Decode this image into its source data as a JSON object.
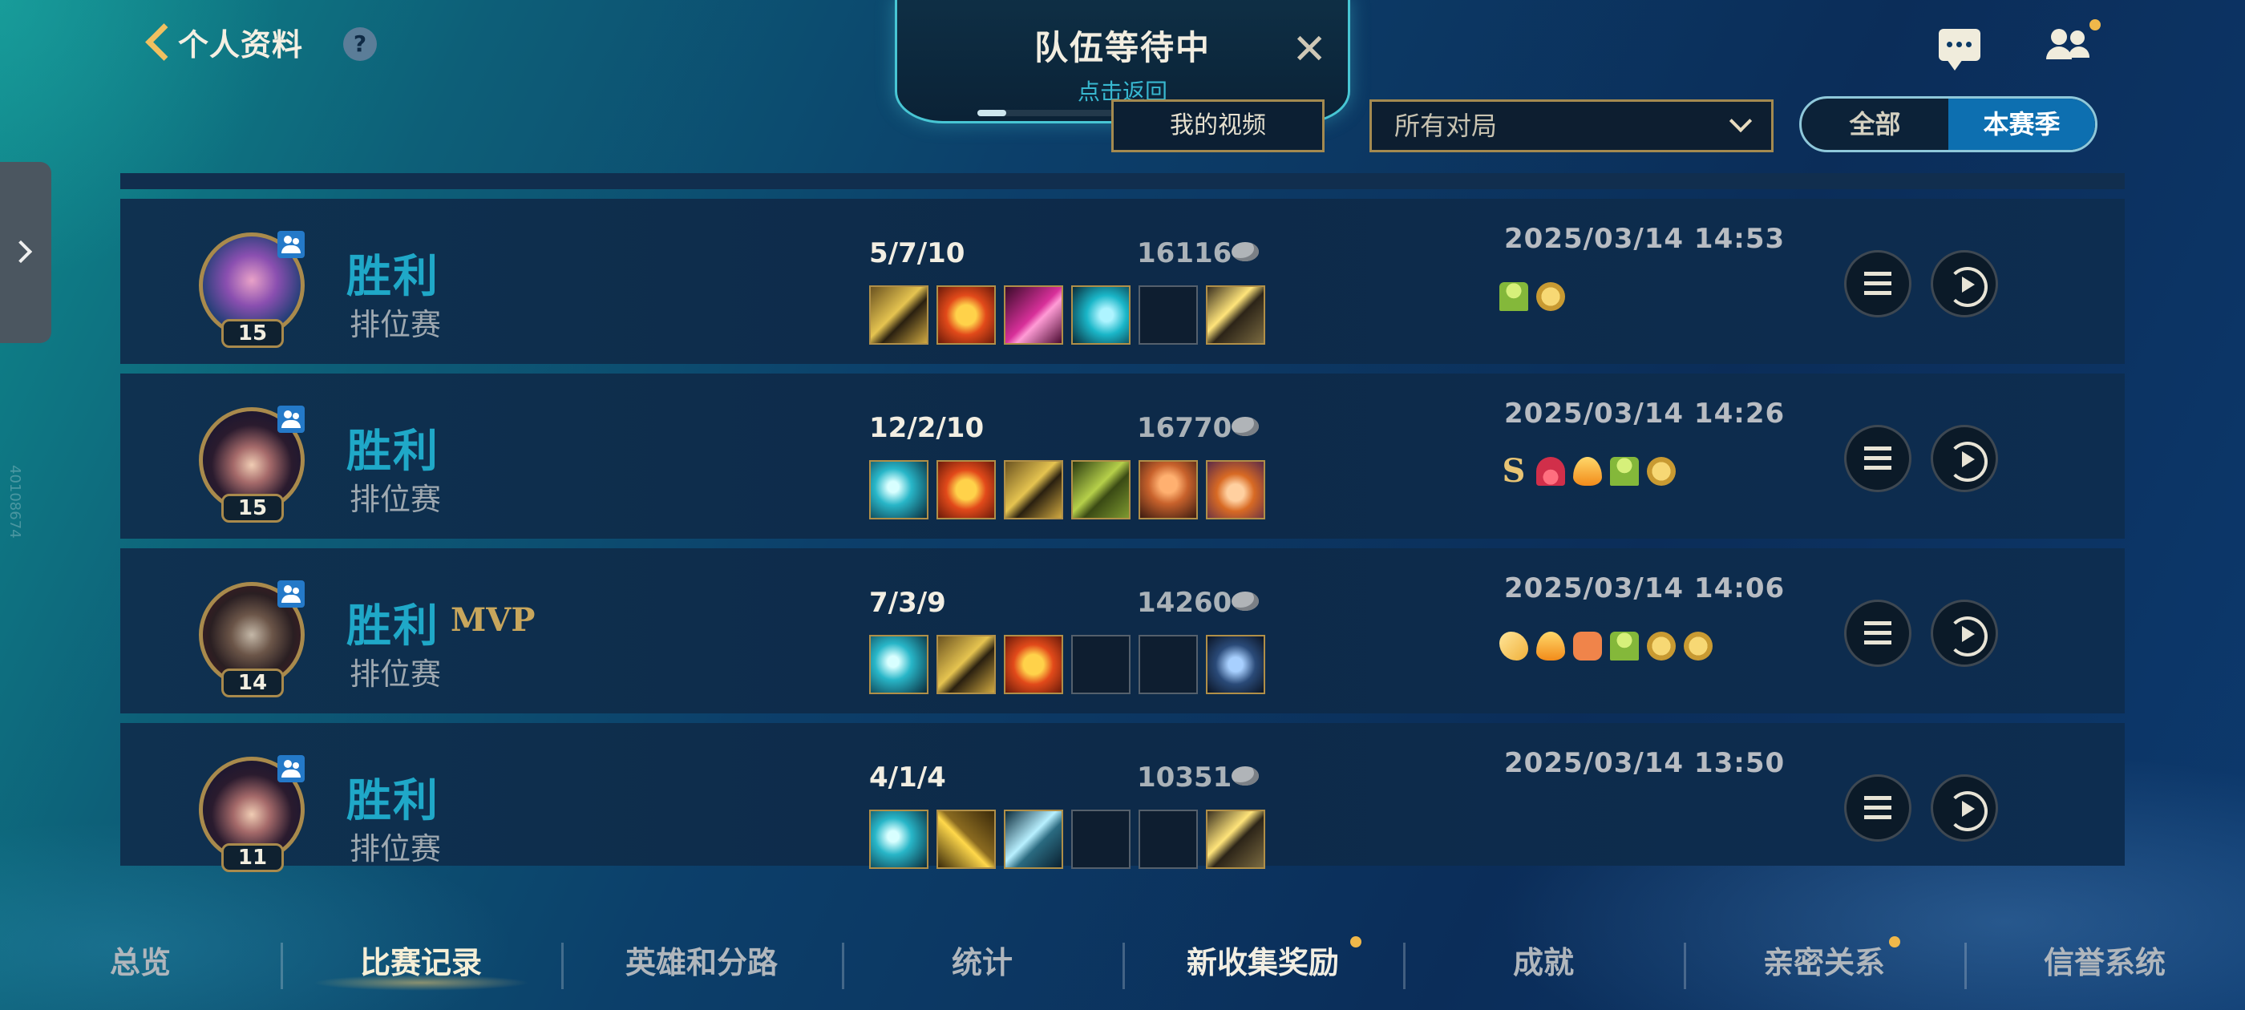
{
  "header": {
    "back_label": "个人资料",
    "help_label": "?"
  },
  "queue": {
    "title": "队伍等待中",
    "subtitle": "点击返回",
    "close_label": "✕",
    "progress": 0.1
  },
  "toolbar": {
    "video_label": "我的视频",
    "filter_value": "所有对局",
    "seg_all": "全部",
    "seg_season": "本赛季"
  },
  "side": {
    "vertical_id": "40108674"
  },
  "matches": [
    {
      "result": "胜利",
      "mvp": "",
      "mode": "排位赛",
      "level": "15",
      "kda": "5/7/10",
      "gold": "16116",
      "datetime": "2025/03/14 14:53"
    },
    {
      "result": "胜利",
      "mvp": "",
      "mode": "排位赛",
      "level": "15",
      "kda": "12/2/10",
      "gold": "16770",
      "datetime": "2025/03/14 14:26"
    },
    {
      "result": "胜利",
      "mvp": "MVP",
      "mode": "排位赛",
      "level": "14",
      "kda": "7/3/9",
      "gold": "14260",
      "datetime": "2025/03/14 14:06"
    },
    {
      "result": "胜利",
      "mvp": "",
      "mode": "排位赛",
      "level": "11",
      "kda": "4/1/4",
      "gold": "10351",
      "datetime": "2025/03/14 13:50"
    }
  ],
  "nav": {
    "tabs": [
      "总览",
      "比赛记录",
      "英雄和分路",
      "统计",
      "新收集奖励",
      "成就",
      "亲密关系",
      "信誉系统"
    ]
  },
  "colors": {
    "win": "#1fa8c8",
    "accent_gold": "#a48a50",
    "seg_active": "#0d6fb0"
  }
}
